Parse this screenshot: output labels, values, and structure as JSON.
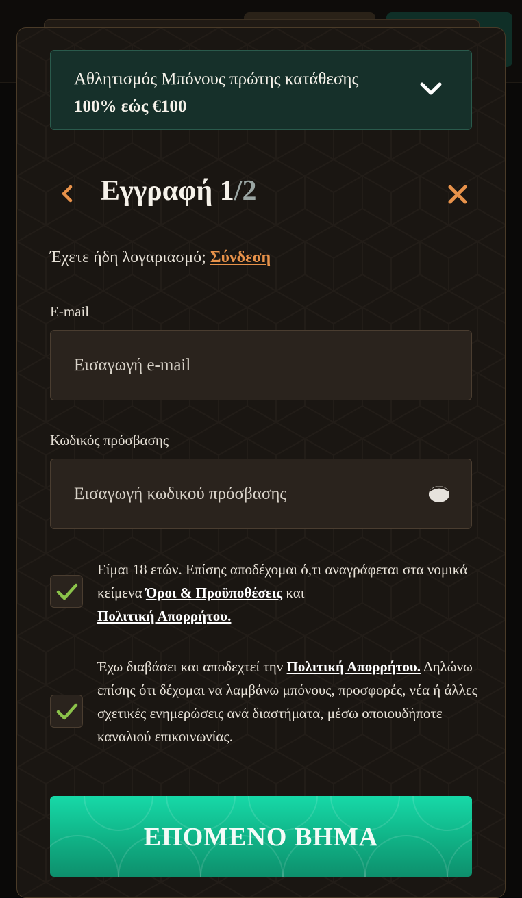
{
  "bonus": {
    "line1": "Αθλητισμός Μπόνους πρώτης κατάθεσης",
    "line2": "100% εώς €100",
    "chevron_icon": "chevron-down-icon"
  },
  "header": {
    "title": "Εγγραφή",
    "step_current": "1",
    "step_total": "/2",
    "back_icon": "chevron-left-icon",
    "close_icon": "close-icon"
  },
  "login_prompt": {
    "text": "Έχετε ήδη λογαριασμό;",
    "link": "Σύνδεση"
  },
  "email": {
    "label": "E-mail",
    "placeholder": "Εισαγωγή e-mail"
  },
  "password": {
    "label": "Κωδικός πρόσβασης",
    "placeholder": "Εισαγωγή κωδικού πρόσβασης",
    "toggle_icon": "eye-icon"
  },
  "consent1": {
    "checked": true,
    "text_before": "Είμαι 18 ετών. Επίσης αποδέχομαι ό,τι αναγράφεται στα νομικά κείμενα ",
    "link1": "Όροι & Προϋποθέσεις",
    "text_mid": " και ",
    "link2": "Πολιτική Απορρήτου."
  },
  "consent2": {
    "checked": true,
    "text_before": "Έχω διαβάσει και αποδεχτεί την ",
    "link1": "Πολιτική Απορρήτου.",
    "text_after": " Δηλώνω επίσης ότι δέχομαι να λαμβάνω μπόνους, προσφορές, νέα ή άλλες σχετικές ενημερώσεις ανά διαστήματα, μέσω οποιουδήποτε καναλιού επικοινωνίας."
  },
  "next_button": {
    "label": "ΕΠΟΜΕΝΟ ΒΗΜΑ"
  },
  "colors": {
    "accent": "#e8924a",
    "primary_button": "#11b88b",
    "check": "#8bc34a",
    "panel": "#1a1612"
  }
}
